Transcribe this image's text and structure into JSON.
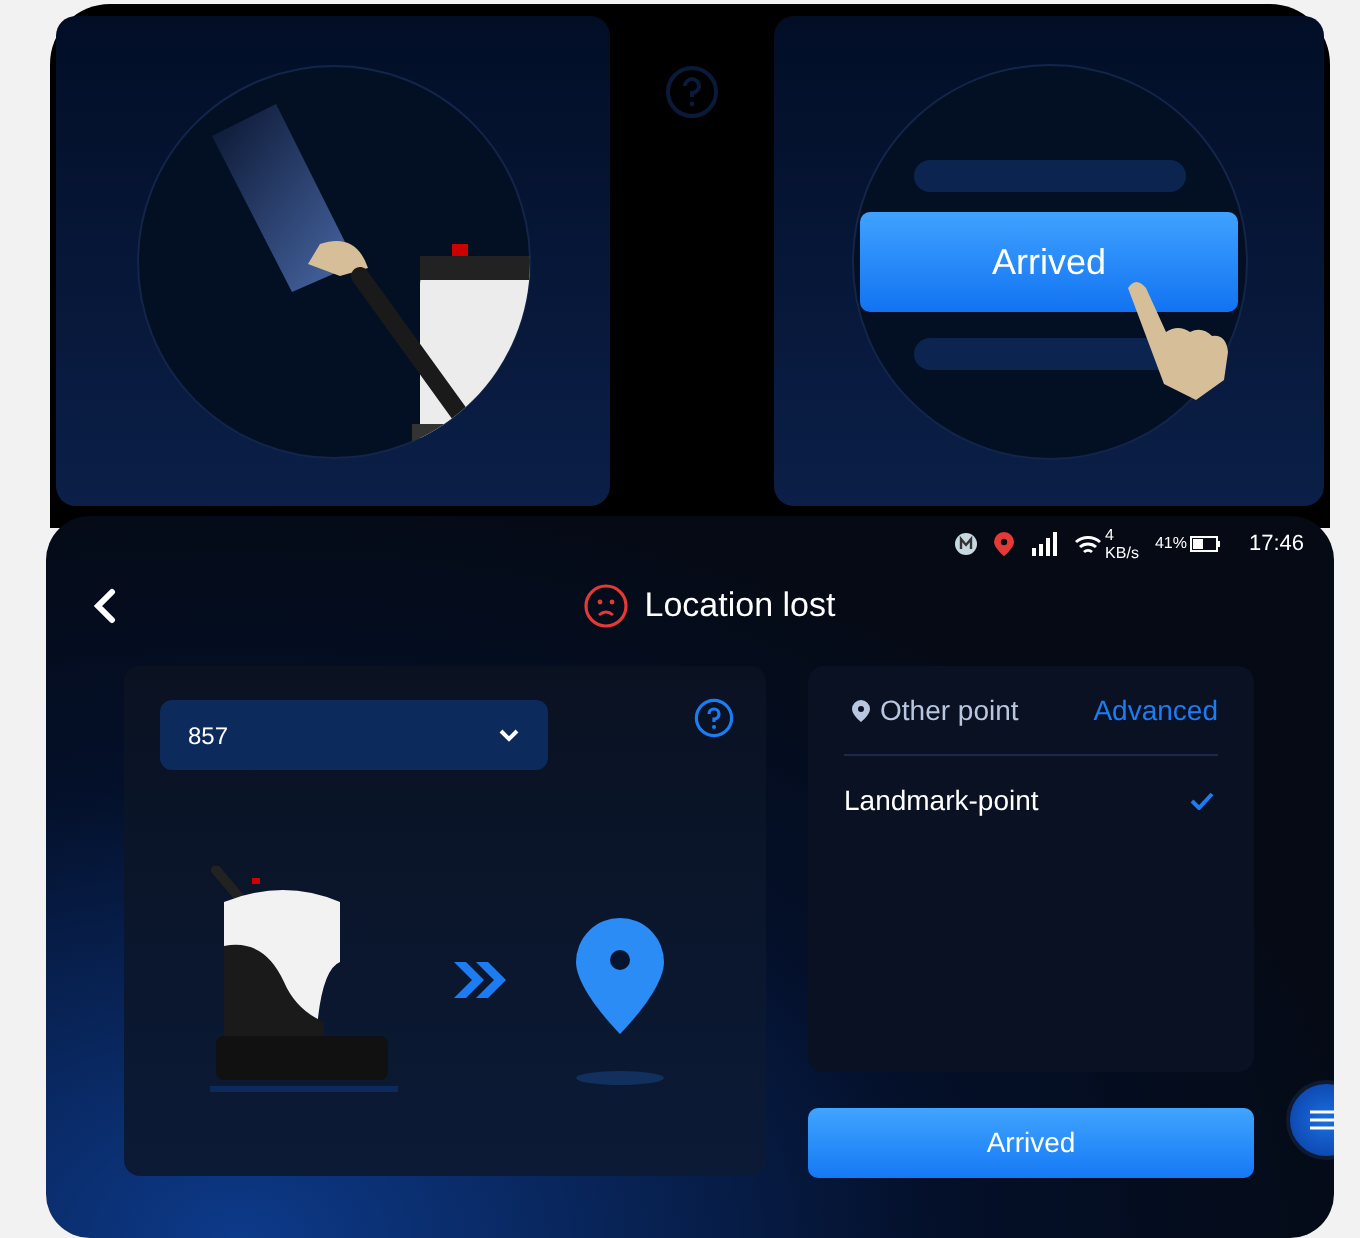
{
  "guide_panels": [
    {
      "kind": "pull_handle"
    },
    {
      "kind": "tap_button",
      "button_label": "Arrived"
    }
  ],
  "status_bar": {
    "wifi_speed": "4",
    "wifi_speed_unit": "KB/s",
    "battery": "41%",
    "time": "17:46"
  },
  "header": {
    "title": "Location lost"
  },
  "map_select": {
    "value": "857"
  },
  "points": {
    "heading": "Other point",
    "advanced_link": "Advanced",
    "items": [
      {
        "label": "Landmark-point",
        "selected": true
      }
    ]
  },
  "primary_button": {
    "label": "Arrived"
  }
}
